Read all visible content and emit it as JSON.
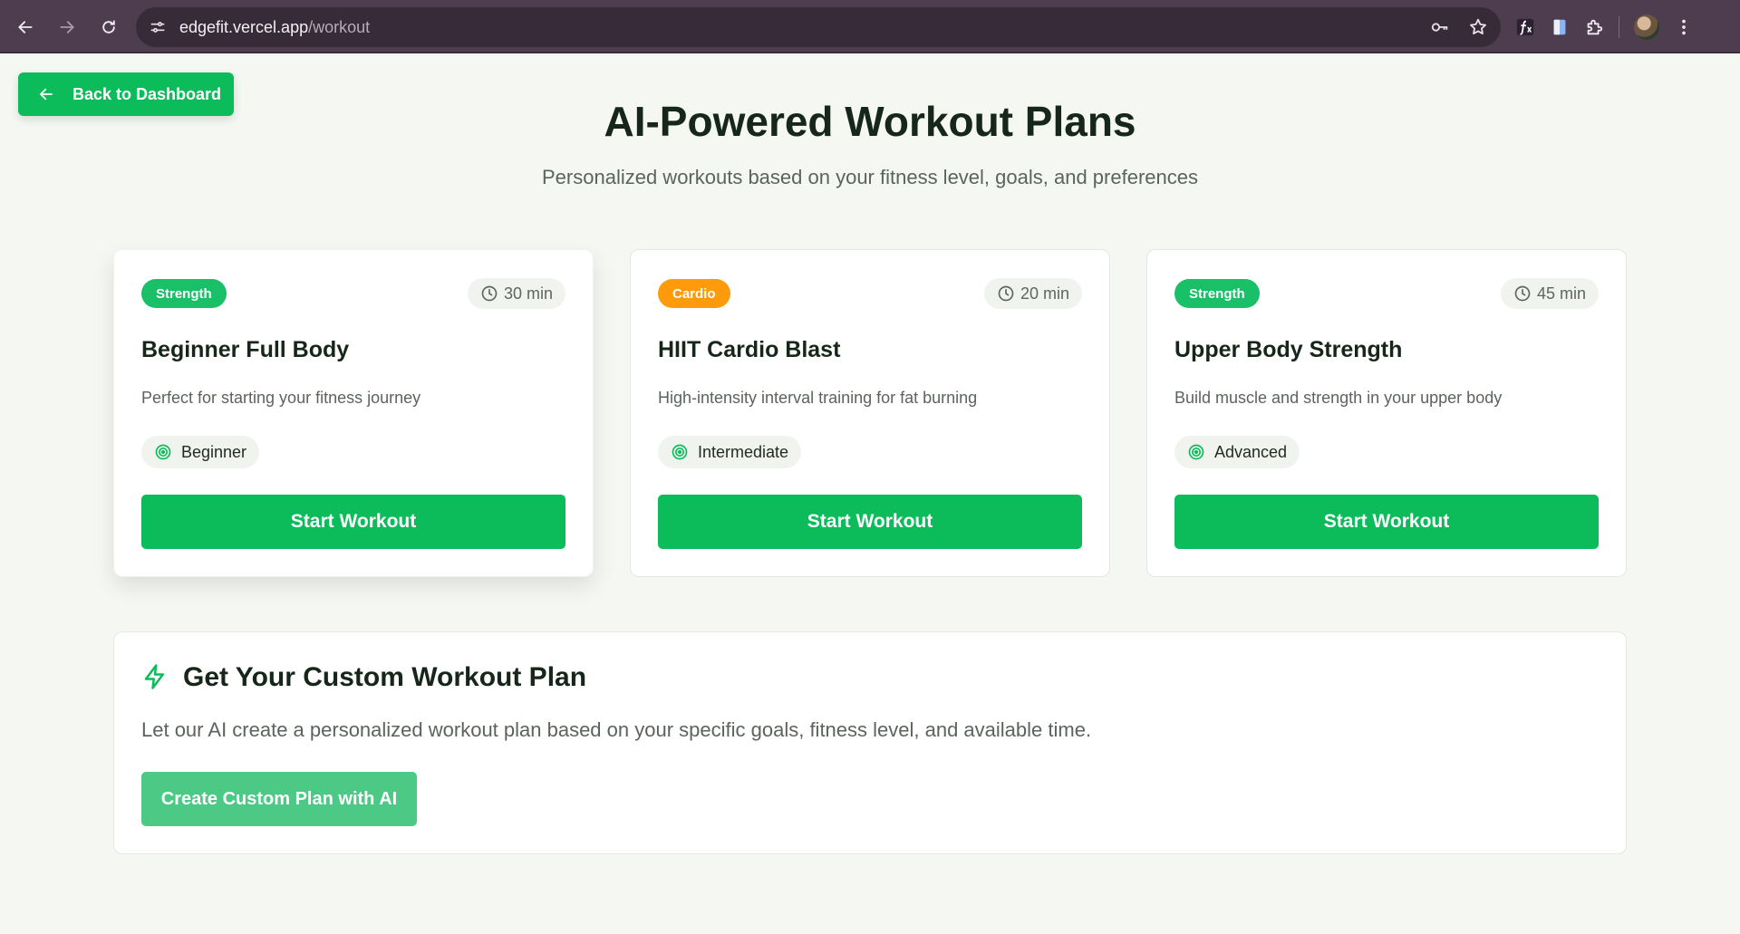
{
  "browser": {
    "url_host": "edgefit.vercel.app",
    "url_path": "/workout"
  },
  "page": {
    "back_label": "Back to Dashboard",
    "title": "AI-Powered Workout Plans",
    "subtitle": "Personalized workouts based on your fitness level, goals, and preferences"
  },
  "workouts": [
    {
      "category": "Strength",
      "category_color": "#19c067",
      "duration": "30 min",
      "title": "Beginner Full Body",
      "description": "Perfect for starting your fitness journey",
      "level": "Beginner",
      "button": "Start Workout"
    },
    {
      "category": "Cardio",
      "category_color": "#ff9a0a",
      "duration": "20 min",
      "title": "HIIT Cardio Blast",
      "description": "High-intensity interval training for fat burning",
      "level": "Intermediate",
      "button": "Start Workout"
    },
    {
      "category": "Strength",
      "category_color": "#19c067",
      "duration": "45 min",
      "title": "Upper Body Strength",
      "description": "Build muscle and strength in your upper body",
      "level": "Advanced",
      "button": "Start Workout"
    }
  ],
  "custom": {
    "title": "Get Your Custom Workout Plan",
    "description": "Let our AI create a personalized workout plan based on your specific goals, fitness level, and available time.",
    "button": "Create Custom Plan with AI"
  },
  "colors": {
    "accent": "#0cbc5a",
    "accent_light": "#4cc984"
  },
  "icons": {
    "back": "arrow-left-icon",
    "duration": "clock-icon",
    "level": "target-icon",
    "custom": "lightning-bolt-icon"
  }
}
